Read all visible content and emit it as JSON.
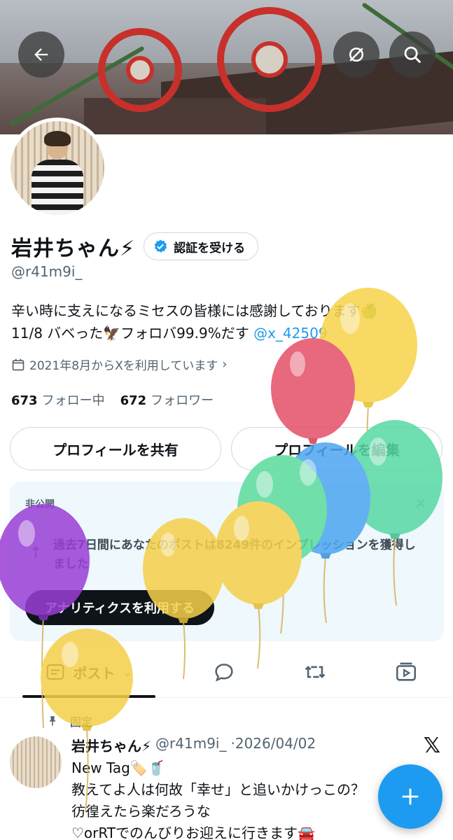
{
  "profile": {
    "display_name": "岩井ちゃん⚡︎",
    "verify_button": "認証を受ける",
    "handle": "@r41m9i_",
    "bio_line1": "辛い時に支えになるミセスの皆様には感謝しております🍏",
    "bio_line2_text": "11/8 バベった🦅フォロバ99.9%だす ",
    "bio_line2_link": "@x_42509",
    "joined": "2021年8月からXを利用しています",
    "following_count": "673",
    "following_label": "フォロー中",
    "followers_count": "672",
    "followers_label": "フォロワー"
  },
  "actions": {
    "share_profile": "プロフィールを共有",
    "edit_profile": "プロフィールを編集"
  },
  "analytics_card": {
    "tag": "非公開",
    "message": "過去7日間にあなたのポストは8249件のインプレッションを獲得しました",
    "cta": "アナリティクスを利用する"
  },
  "tabs": {
    "posts": "ポスト"
  },
  "pinned_post": {
    "pinned_label": "固定",
    "author_name": "岩井ちゃん⚡︎",
    "author_handle": "@r41m9i_",
    "date": "·2026/04/02",
    "text": "New Tag🏷️🥤\n教えてよ人は何故「幸せ」と追いかけっこの？　彷徨えたら楽だろうな\n♡orRTでのんびりお迎えに行きます🚘"
  },
  "colors": {
    "accent": "#1d9bf0",
    "text": "#0f1419",
    "secondary": "#536471",
    "card_bg": "#eef8fd"
  },
  "icons": [
    "back-arrow-icon",
    "no-sync-icon",
    "search-icon",
    "verified-check-icon",
    "calendar-icon",
    "chevron-right-icon",
    "close-icon",
    "up-arrow-icon",
    "posts-tab-icon",
    "reply-icon",
    "repost-icon",
    "media-icon",
    "pin-icon",
    "x-logo-icon",
    "plus-icon"
  ]
}
